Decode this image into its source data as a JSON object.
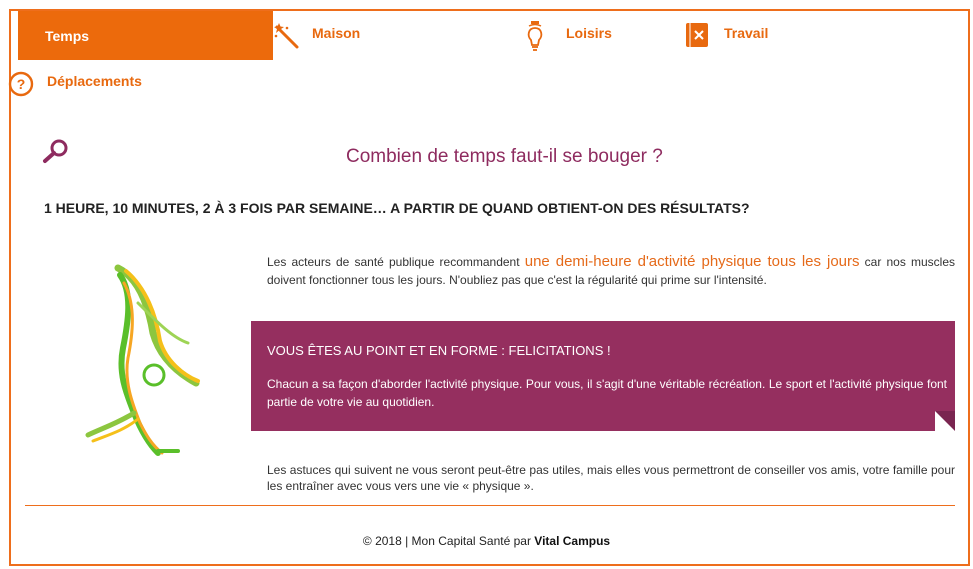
{
  "nav": {
    "tabs": [
      {
        "label": "Temps",
        "icon": "none",
        "active": true
      },
      {
        "label": "Maison",
        "icon": "magic-wand-icon"
      },
      {
        "label": "Loisirs",
        "icon": "lightbulb-icon"
      },
      {
        "label": "Travail",
        "icon": "notebook-icon"
      },
      {
        "label": "Déplacements",
        "icon": "question-circle-icon"
      }
    ]
  },
  "main": {
    "title": "Combien de temps faut-il se bouger ?",
    "subtitle": "1 HEURE, 10 MINUTES, 2 À 3 FOIS PAR SEMAINE… A PARTIR DE QUAND OBTIENT-ON DES RÉSULTATS?",
    "para1_before": "Les acteurs de santé publique recommandent ",
    "para1_highlight": "une demi-heure d'activité physique tous les jours",
    "para1_after": " car nos muscles doivent fonctionner tous les jours. N'oubliez pas que c'est la régularité qui prime sur l'intensité.",
    "box_heading": "VOUS ÊTES AU POINT ET EN FORME : FELICITATIONS !",
    "box_text": "Chacun a sa façon d'aborder l'activité physique. Pour vous, il s'agit d'une véritable récréation. Le sport et l'activité physique font partie de votre vie au quotidien.",
    "para2": "Les astuces qui suivent ne vous seront peut-être pas utiles, mais elles vous permettront de conseiller vos amis, votre famille pour les entraîner avec vous vers une vie « physique »."
  },
  "footer": {
    "text": "© 2018 | Mon Capital Santé par ",
    "brand": "Vital Campus"
  },
  "colors": {
    "accent": "#ec6a0c",
    "title": "#8e2b5f",
    "box": "#952f5f"
  }
}
